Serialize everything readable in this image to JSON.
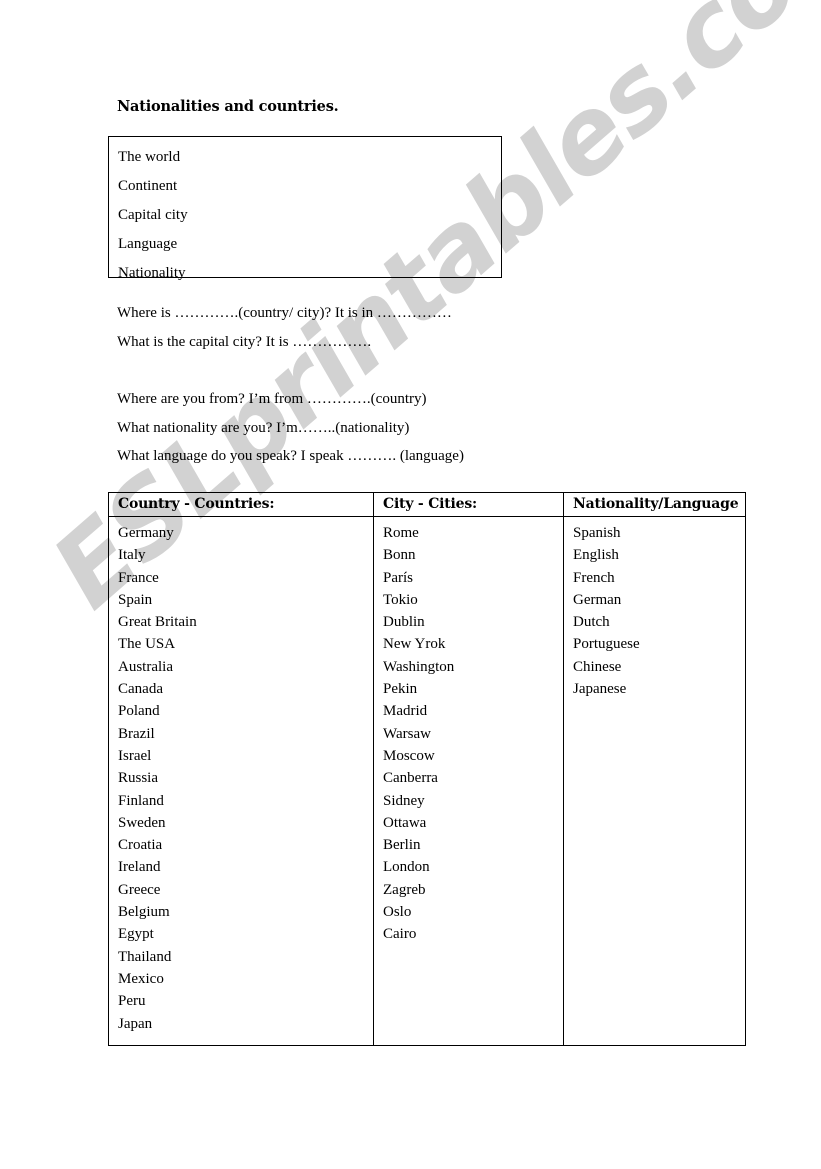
{
  "document": {
    "title": "Nationalities and countries."
  },
  "vocab_box": {
    "items": [
      "The world",
      "Continent",
      "Capital city",
      "Language",
      "Nationality"
    ]
  },
  "questions": {
    "group_a": [
      "Where is ………….(country/ city)? It is in ……………",
      "What is the capital city? It is ……………."
    ],
    "group_b": [
      "Where are you from? I’m from ………….(country)",
      "What nationality are you? I’m……..(nationality)",
      "What language do you speak? I speak ………. (language)"
    ]
  },
  "table": {
    "headers": [
      "Country - Countries:",
      "City - Cities:",
      "Nationality/Language"
    ],
    "countries": [
      "Germany",
      "Italy",
      "France",
      "Spain",
      "Great Britain",
      "The USA",
      "Australia",
      "Canada",
      "Poland",
      "Brazil",
      "Israel",
      "Russia",
      "Finland",
      "Sweden",
      "Croatia",
      "Ireland",
      "Greece",
      "Belgium",
      "Egypt",
      "Thailand",
      "Mexico",
      "Peru",
      "Japan"
    ],
    "cities": [
      "Rome",
      "Bonn",
      "París",
      "Tokio",
      "Dublin",
      "New Yrok",
      "Washington",
      "Pekin",
      "Madrid",
      "Warsaw",
      "Moscow",
      "Canberra",
      "Sidney",
      "Ottawa",
      "Berlin",
      "London",
      "Zagreb",
      "Oslo",
      "Cairo"
    ],
    "nationalities": [
      "Spanish",
      "English",
      "French",
      "German",
      "Dutch",
      "Portuguese",
      "Chinese",
      "Japanese"
    ]
  },
  "watermark": {
    "text": "ESLprintables.com",
    "color": "#d2d2d2"
  }
}
